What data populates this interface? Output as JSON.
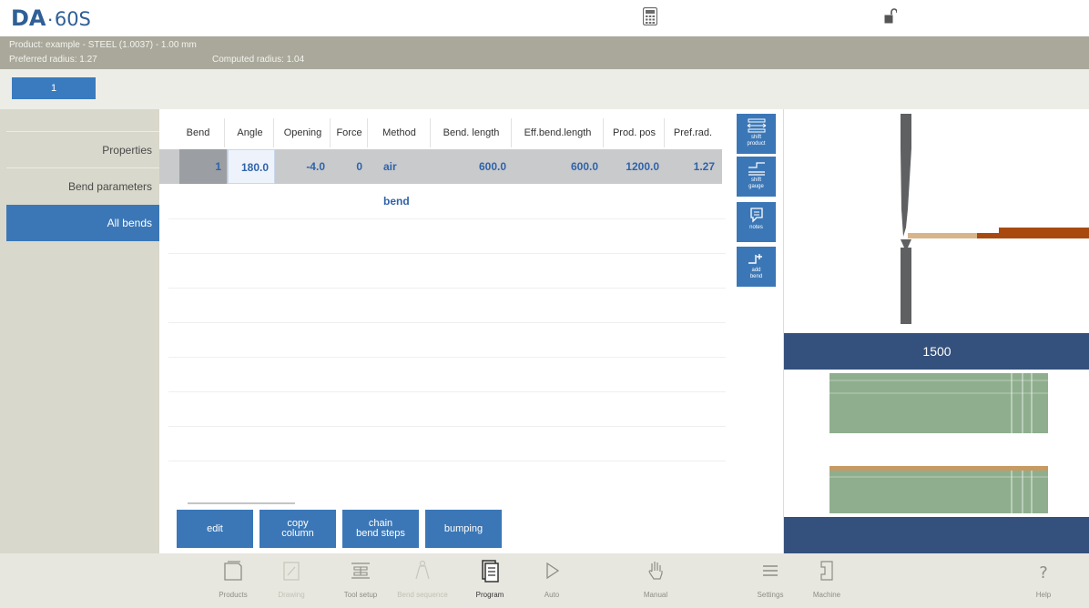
{
  "app": {
    "logo_brand": "DA",
    "logo_dot": "·",
    "logo_model": "60S"
  },
  "infobar": {
    "product_line": "Product: example - STEEL (1.0037) - 1.00 mm",
    "preferred_radius": "Preferred radius: 1.27",
    "computed_radius": "Computed radius: 1.04"
  },
  "product_tabs": [
    {
      "label": "1"
    }
  ],
  "left_nav": {
    "items": [
      {
        "label": "Properties"
      },
      {
        "label": "Bend parameters"
      },
      {
        "label": "All bends"
      }
    ]
  },
  "table": {
    "columns": [
      "Bend",
      "Angle",
      "Opening",
      "Force",
      "Method",
      "Bend. length",
      "Eff.bend.length",
      "Prod. pos",
      "Pref.rad."
    ],
    "rows": [
      [
        "1",
        "180.0",
        "-4.0",
        "0",
        "air bend",
        "600.0",
        "600.0",
        "1200.0",
        "1.27"
      ]
    ]
  },
  "actions": {
    "edit": "edit",
    "copy_column_1": "copy",
    "copy_column_2": "column",
    "chain_1": "chain",
    "chain_2": "bend steps",
    "bumping": "bumping"
  },
  "side_buttons": [
    {
      "label_1": "shift",
      "label_2": "product",
      "icon": "shift-product-icon"
    },
    {
      "label_1": "shift",
      "label_2": "gauge",
      "icon": "shift-gauge-icon"
    },
    {
      "label_1": "notes",
      "label_2": "",
      "icon": "notes-icon"
    },
    {
      "label_1": "add",
      "label_2": "bend",
      "icon": "add-bend-icon"
    }
  ],
  "graphic": {
    "table_length": "1500",
    "colors": {
      "sheet_light": "#d9b48a",
      "sheet_dark": "#a84a10",
      "tool_grey": "#5f6062",
      "tool_green": "#8fae8e",
      "table_blue": "#34507c"
    }
  },
  "bottom_nav": [
    {
      "label": "Products",
      "icon": "products-icon"
    },
    {
      "label": "Drawing",
      "icon": "drawing-icon"
    },
    {
      "label": "Tool setup",
      "icon": "tool-setup-icon"
    },
    {
      "label": "Bend sequence",
      "icon": "bend-sequence-icon"
    },
    {
      "label": "Program",
      "icon": "program-icon"
    },
    {
      "label": "Auto",
      "icon": "auto-icon"
    },
    {
      "label": "Manual",
      "icon": "manual-icon"
    },
    {
      "label": "Settings",
      "icon": "settings-icon"
    },
    {
      "label": "Machine",
      "icon": "machine-icon"
    },
    {
      "label": "Help",
      "icon": "help-icon"
    }
  ]
}
